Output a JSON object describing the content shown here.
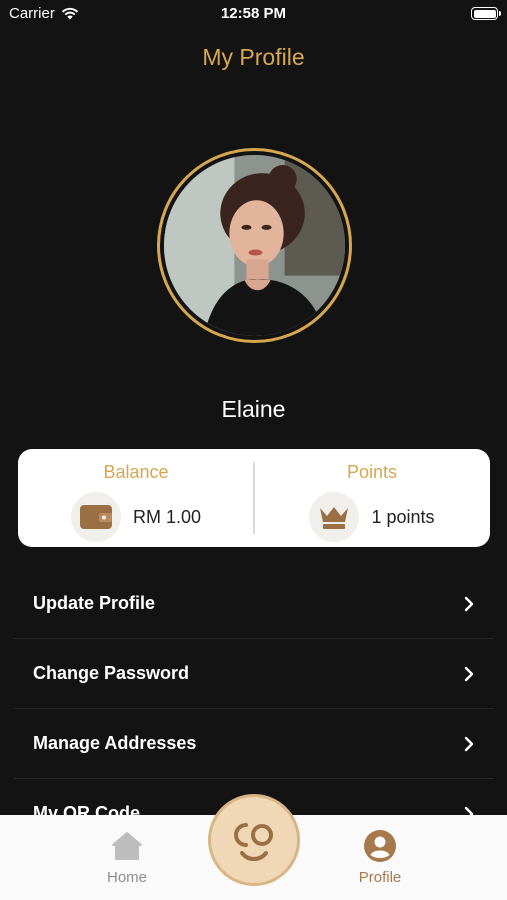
{
  "status_bar": {
    "carrier": "Carrier",
    "time": "12:58 PM"
  },
  "header": {
    "title": "My Profile"
  },
  "profile": {
    "name": "Elaine"
  },
  "stats": {
    "balance": {
      "label": "Balance",
      "value": "RM 1.00",
      "icon": "wallet-icon"
    },
    "points": {
      "label": "Points",
      "value": "1 points",
      "icon": "crown-icon"
    }
  },
  "menu": {
    "items": [
      {
        "label": "Update Profile"
      },
      {
        "label": "Change Password"
      },
      {
        "label": "Manage Addresses"
      },
      {
        "label": "My QR Code"
      }
    ]
  },
  "tab_bar": {
    "home_label": "Home",
    "profile_label": "Profile",
    "center_logo": "co",
    "active_tab": "Profile"
  },
  "colors": {
    "accent": "#d7a74f",
    "background": "#131313",
    "active_tab": "#a77a4e",
    "icon_brown": "#9b6f44"
  }
}
